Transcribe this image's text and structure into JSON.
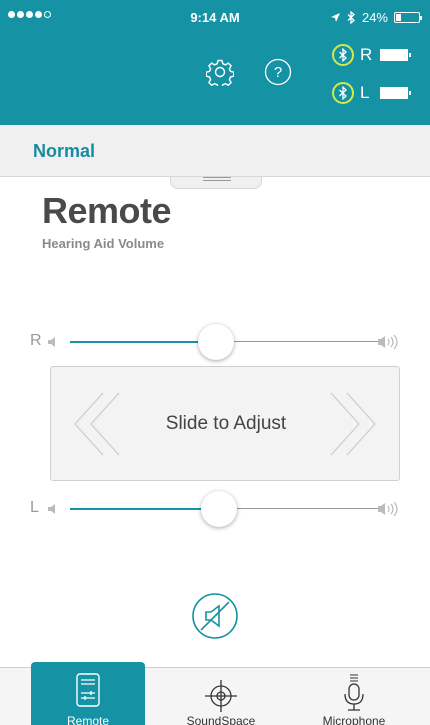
{
  "status_bar": {
    "time": "9:14 AM",
    "battery": "24%"
  },
  "header": {
    "right_ear_label": "R",
    "left_ear_label": "L"
  },
  "program": {
    "name": "Normal"
  },
  "page": {
    "title": "Remote",
    "subtitle": "Hearing Aid Volume"
  },
  "sliders": {
    "right": {
      "label": "R",
      "level": 0.47
    },
    "left": {
      "label": "L",
      "level": 0.48
    }
  },
  "adjust": {
    "label": "Slide to Adjust"
  },
  "tabs": [
    {
      "label": "Remote",
      "icon": "remote-icon",
      "active": true
    },
    {
      "label": "SoundSpace",
      "icon": "crosshair-icon",
      "active": false
    },
    {
      "label": "Microphone",
      "icon": "microphone-icon",
      "active": false
    }
  ],
  "colors": {
    "accent": "#1593a5",
    "bluetooth_ring": "#d4e84a"
  }
}
